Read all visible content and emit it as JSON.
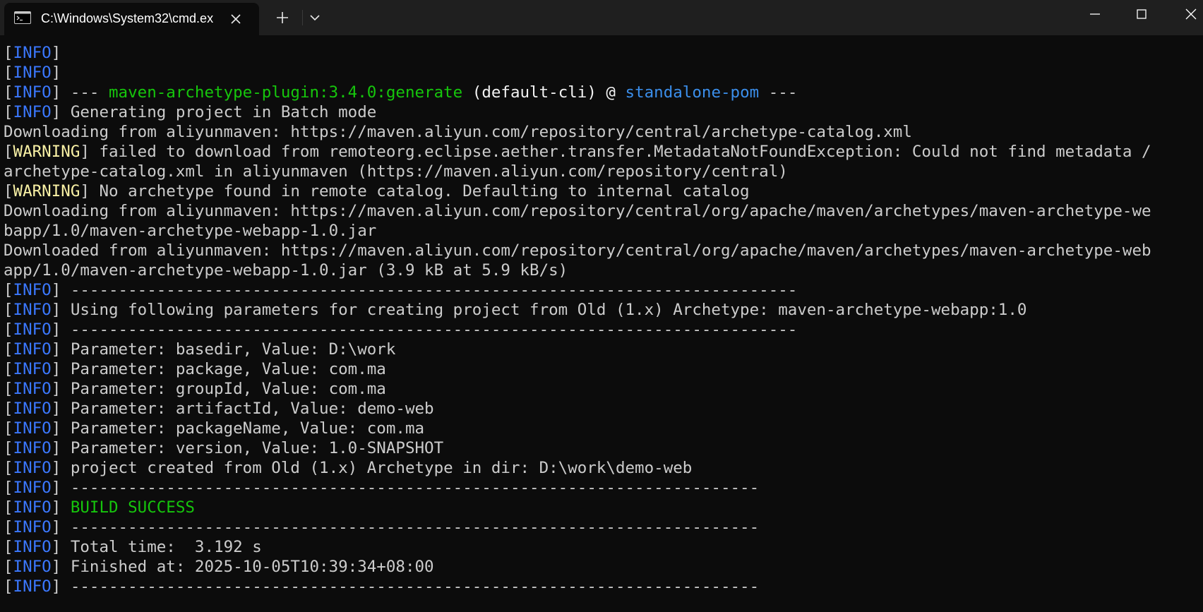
{
  "titlebar": {
    "tab_title": "C:\\Windows\\System32\\cmd.ex",
    "tab_icon": "cmd-icon",
    "close_tab_icon": "close-icon",
    "new_tab_icon": "plus-icon",
    "dropdown_icon": "chevron-down-icon",
    "minimize_icon": "minimize-icon",
    "maximize_icon": "maximize-icon",
    "close_window_icon": "close-icon"
  },
  "colors": {
    "background": "#0c0c0c",
    "text": "#cccccc",
    "info": "#3b78ff",
    "warning": "#f9f1a5",
    "success": "#16c60c",
    "project": "#3b8eea"
  },
  "terminal": {
    "lines": [
      [
        {
          "t": "[",
          "c": ""
        },
        {
          "t": "INFO",
          "c": "info"
        },
        {
          "t": "]",
          "c": ""
        }
      ],
      [
        {
          "t": "[",
          "c": ""
        },
        {
          "t": "INFO",
          "c": "info"
        },
        {
          "t": "]",
          "c": ""
        }
      ],
      [
        {
          "t": "[",
          "c": ""
        },
        {
          "t": "INFO",
          "c": "info"
        },
        {
          "t": "] --- ",
          "c": ""
        },
        {
          "t": "maven-archetype-plugin:3.4.0:generate",
          "c": "green"
        },
        {
          "t": " (default-cli) @ ",
          "c": "bright"
        },
        {
          "t": "standalone-pom",
          "c": "blue"
        },
        {
          "t": " ---",
          "c": ""
        }
      ],
      [
        {
          "t": "[",
          "c": ""
        },
        {
          "t": "INFO",
          "c": "info"
        },
        {
          "t": "] Generating project in Batch mode",
          "c": ""
        }
      ],
      [
        {
          "t": "Downloading from aliyunmaven: https://maven.aliyun.com/repository/central/archetype-catalog.xml",
          "c": ""
        }
      ],
      [
        {
          "t": "[",
          "c": ""
        },
        {
          "t": "WARNING",
          "c": "warn"
        },
        {
          "t": "] failed to download from remoteorg.eclipse.aether.transfer.MetadataNotFoundException: Could not find metadata /",
          "c": ""
        }
      ],
      [
        {
          "t": "archetype-catalog.xml in aliyunmaven (https://maven.aliyun.com/repository/central)",
          "c": ""
        }
      ],
      [
        {
          "t": "[",
          "c": ""
        },
        {
          "t": "WARNING",
          "c": "warn"
        },
        {
          "t": "] No archetype found in remote catalog. Defaulting to internal catalog",
          "c": ""
        }
      ],
      [
        {
          "t": "Downloading from aliyunmaven: https://maven.aliyun.com/repository/central/org/apache/maven/archetypes/maven-archetype-we",
          "c": ""
        }
      ],
      [
        {
          "t": "bapp/1.0/maven-archetype-webapp-1.0.jar",
          "c": ""
        }
      ],
      [
        {
          "t": "Downloaded from aliyunmaven: https://maven.aliyun.com/repository/central/org/apache/maven/archetypes/maven-archetype-web",
          "c": ""
        }
      ],
      [
        {
          "t": "app/1.0/maven-archetype-webapp-1.0.jar (3.9 kB at 5.9 kB/s)",
          "c": ""
        }
      ],
      [
        {
          "t": "[",
          "c": ""
        },
        {
          "t": "INFO",
          "c": "info"
        },
        {
          "t": "] ----------------------------------------------------------------------------",
          "c": ""
        }
      ],
      [
        {
          "t": "[",
          "c": ""
        },
        {
          "t": "INFO",
          "c": "info"
        },
        {
          "t": "] Using following parameters for creating project from Old (1.x) Archetype: maven-archetype-webapp:1.0",
          "c": ""
        }
      ],
      [
        {
          "t": "[",
          "c": ""
        },
        {
          "t": "INFO",
          "c": "info"
        },
        {
          "t": "] ----------------------------------------------------------------------------",
          "c": ""
        }
      ],
      [
        {
          "t": "[",
          "c": ""
        },
        {
          "t": "INFO",
          "c": "info"
        },
        {
          "t": "] Parameter: basedir, Value: D:\\work",
          "c": ""
        }
      ],
      [
        {
          "t": "[",
          "c": ""
        },
        {
          "t": "INFO",
          "c": "info"
        },
        {
          "t": "] Parameter: package, Value: com.ma",
          "c": ""
        }
      ],
      [
        {
          "t": "[",
          "c": ""
        },
        {
          "t": "INFO",
          "c": "info"
        },
        {
          "t": "] Parameter: groupId, Value: com.ma",
          "c": ""
        }
      ],
      [
        {
          "t": "[",
          "c": ""
        },
        {
          "t": "INFO",
          "c": "info"
        },
        {
          "t": "] Parameter: artifactId, Value: demo-web",
          "c": ""
        }
      ],
      [
        {
          "t": "[",
          "c": ""
        },
        {
          "t": "INFO",
          "c": "info"
        },
        {
          "t": "] Parameter: packageName, Value: com.ma",
          "c": ""
        }
      ],
      [
        {
          "t": "[",
          "c": ""
        },
        {
          "t": "INFO",
          "c": "info"
        },
        {
          "t": "] Parameter: version, Value: 1.0-SNAPSHOT",
          "c": ""
        }
      ],
      [
        {
          "t": "[",
          "c": ""
        },
        {
          "t": "INFO",
          "c": "info"
        },
        {
          "t": "] project created from Old (1.x) Archetype in dir: D:\\work\\demo-web",
          "c": ""
        }
      ],
      [
        {
          "t": "[",
          "c": ""
        },
        {
          "t": "INFO",
          "c": "info"
        },
        {
          "t": "] ------------------------------------------------------------------------",
          "c": ""
        }
      ],
      [
        {
          "t": "[",
          "c": ""
        },
        {
          "t": "INFO",
          "c": "info"
        },
        {
          "t": "] ",
          "c": ""
        },
        {
          "t": "BUILD SUCCESS",
          "c": "green"
        }
      ],
      [
        {
          "t": "[",
          "c": ""
        },
        {
          "t": "INFO",
          "c": "info"
        },
        {
          "t": "] ------------------------------------------------------------------------",
          "c": ""
        }
      ],
      [
        {
          "t": "[",
          "c": ""
        },
        {
          "t": "INFO",
          "c": "info"
        },
        {
          "t": "] Total time:  3.192 s",
          "c": ""
        }
      ],
      [
        {
          "t": "[",
          "c": ""
        },
        {
          "t": "INFO",
          "c": "info"
        },
        {
          "t": "] Finished at: 2025-10-05T10:39:34+08:00",
          "c": ""
        }
      ],
      [
        {
          "t": "[",
          "c": ""
        },
        {
          "t": "INFO",
          "c": "info"
        },
        {
          "t": "] ------------------------------------------------------------------------",
          "c": ""
        }
      ]
    ]
  }
}
